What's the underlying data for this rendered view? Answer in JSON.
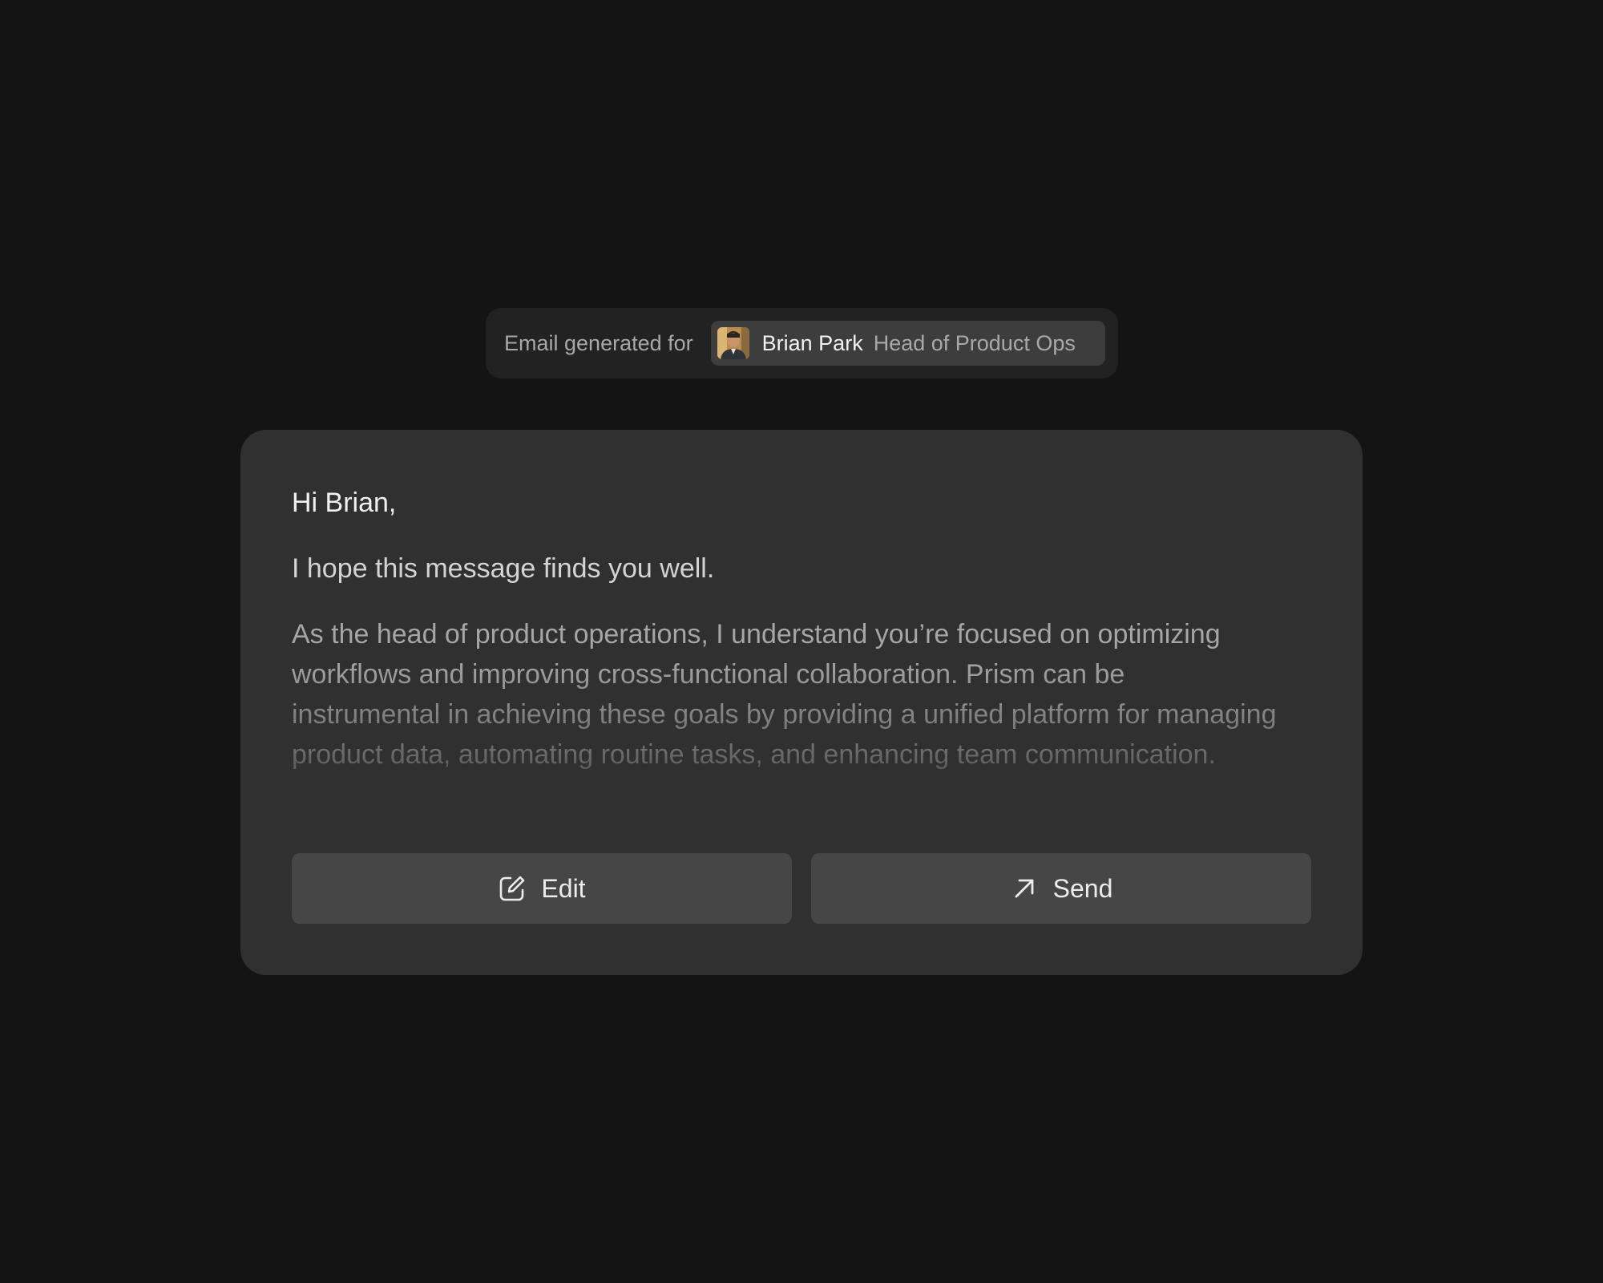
{
  "recipient": {
    "label": "Email generated for",
    "name": "Brian Park",
    "title": "Head of Product Ops",
    "avatar_icon": "person-photo"
  },
  "email": {
    "greeting": "Hi Brian,",
    "intro": "I hope this message finds you well.",
    "body": "As the head of product operations, I understand you’re focused on optimizing workflows and improving cross-functional collaboration. Prism can be instrumental in achieving these goals by providing a unified platform for managing product data, automating routine tasks, and enhancing team communication."
  },
  "actions": {
    "edit": {
      "label": "Edit",
      "icon": "edit-icon"
    },
    "send": {
      "label": "Send",
      "icon": "arrow-up-right-icon"
    }
  },
  "colors": {
    "background": "#141414",
    "card": "#303030",
    "pill": "#222222",
    "chip": "#3d3d3d",
    "button": "#464646"
  }
}
